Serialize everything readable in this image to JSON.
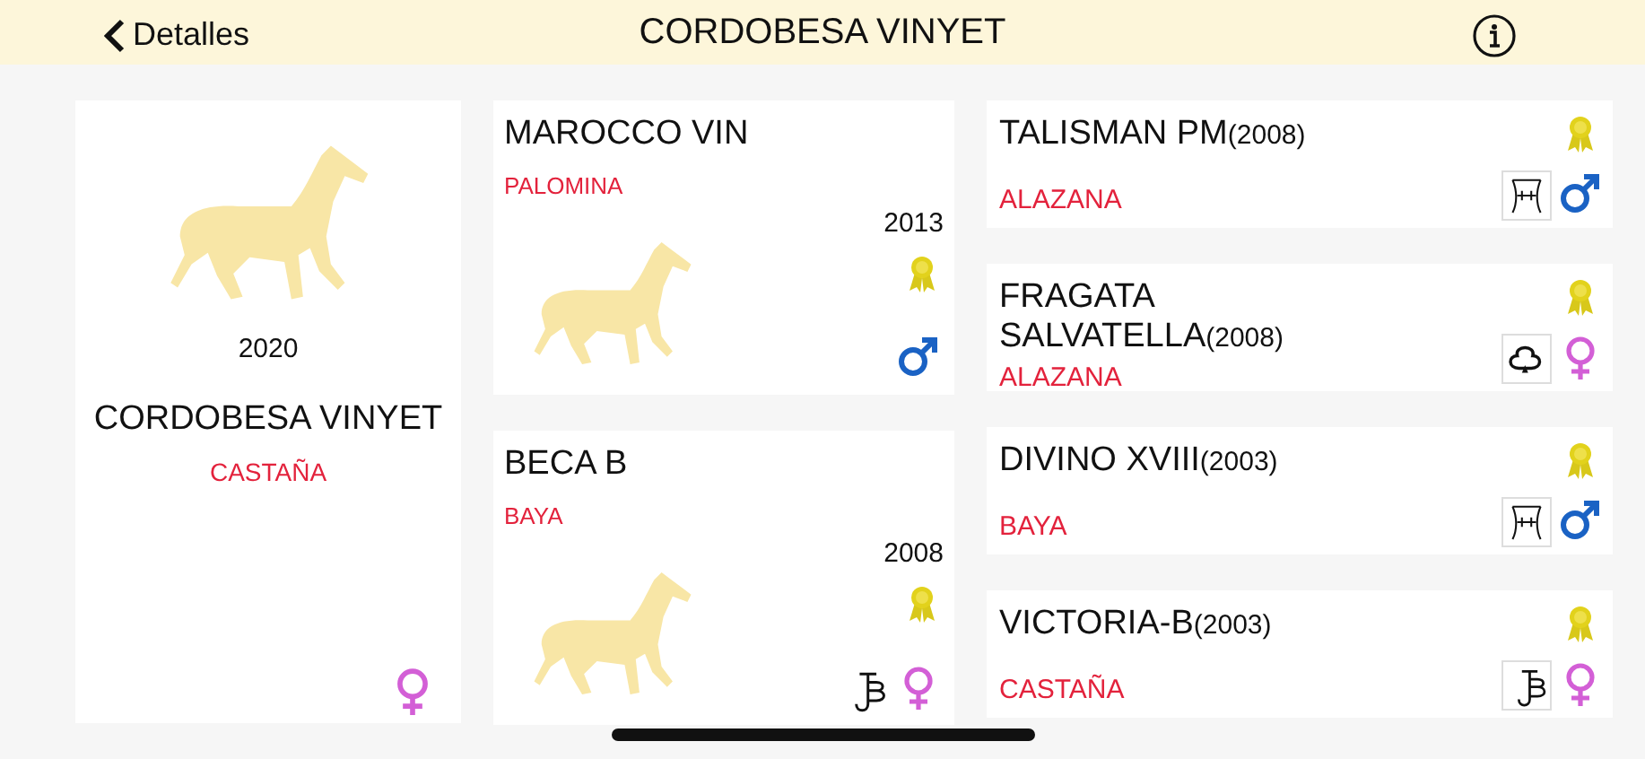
{
  "header": {
    "back_label": "Detalles",
    "title": "CORDOBESA VINYET"
  },
  "subject": {
    "year": "2020",
    "name": "CORDOBESA VINYET",
    "coat": "CASTAÑA",
    "male": false
  },
  "parents": [
    {
      "name": "MAROCCO VIN",
      "coat": "PALOMINA",
      "year": "2013",
      "awarded": true,
      "male": true
    },
    {
      "name": "BECA B",
      "coat": "BAYA",
      "year": "2008",
      "awarded": true,
      "brand": {
        "kind": "jb"
      },
      "male": false
    }
  ],
  "grandparents": [
    {
      "name": "TALISMAN PM",
      "year": "(2008)",
      "coat": "ALAZANA",
      "awarded": true,
      "brand": {
        "kind": "frame"
      },
      "male": true
    },
    {
      "name": "FRAGATA SALVATELLA",
      "year": "(2008)",
      "coat": "ALAZANA",
      "awarded": true,
      "brand": {
        "kind": "club"
      },
      "male": false
    },
    {
      "name": "DIVINO XVIII",
      "year": "(2003)",
      "coat": "BAYA",
      "awarded": true,
      "brand": {
        "kind": "frame"
      },
      "male": true
    },
    {
      "name": "VICTORIA-B",
      "year": "(2003)",
      "coat": "CASTAÑA",
      "awarded": true,
      "brand": {
        "kind": "jb"
      },
      "male": false
    }
  ]
}
